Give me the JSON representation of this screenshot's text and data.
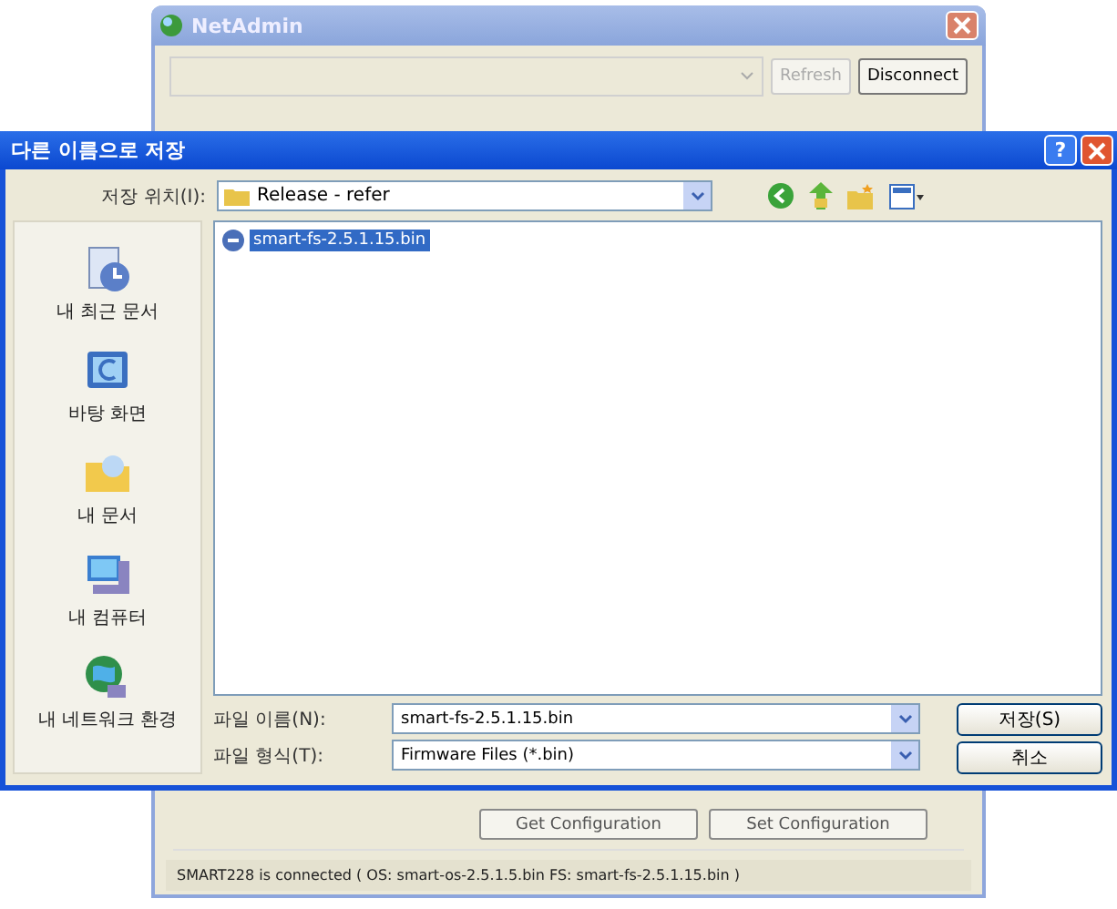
{
  "background_window": {
    "title": "NetAdmin",
    "toolbar_buttons": [
      {
        "label": "Refresh",
        "disabled": true
      },
      {
        "label": "Disconnect",
        "disabled": false
      }
    ],
    "config_buttons": [
      "Get Configuration",
      "Set Configuration"
    ],
    "status_bar": "SMART228 is connected ( OS: smart-os-2.5.1.5.bin FS: smart-fs-2.5.1.15.bin )"
  },
  "dialog": {
    "title": "다른 이름으로 저장",
    "help_button": "?",
    "save_in_label": "저장 위치(I):",
    "save_in": "Release - refer",
    "places": [
      "내 최근 문서",
      "바탕 화면",
      "내 문서",
      "내 컴퓨터",
      "내 네트워크 환경"
    ],
    "files": [
      {
        "name": "smart-fs-2.5.1.15.bin",
        "selected": true
      }
    ],
    "file_name_label": "파일 이름(N):",
    "file_name": "smart-fs-2.5.1.15.bin",
    "file_type_label": "파일 형식(T):",
    "file_type": "Firmware Files (*.bin)",
    "buttons": [
      "저장(S)",
      "취소"
    ]
  }
}
